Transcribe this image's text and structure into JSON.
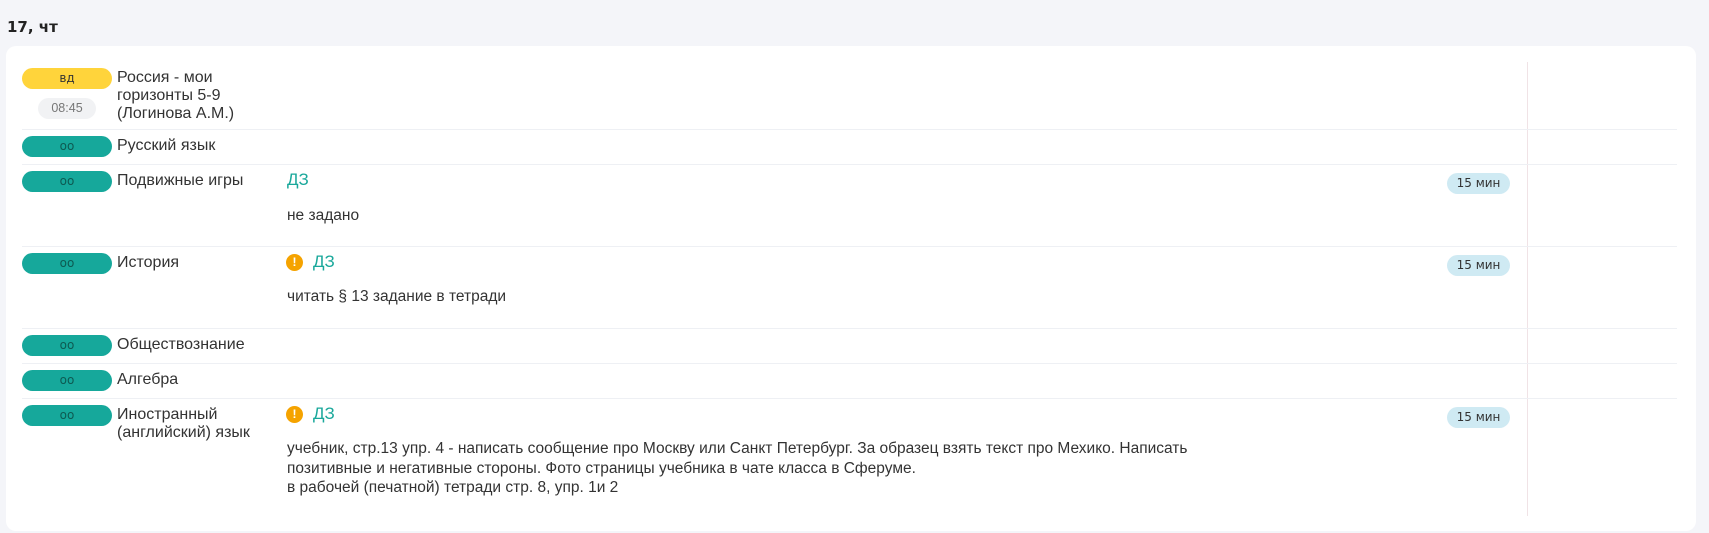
{
  "day": {
    "label": "17, чт"
  },
  "lessons": [
    {
      "badge": "вд",
      "time": "08:45",
      "subject": "Россия - мои горизонты 5-9 (Логинова А.М.)"
    },
    {
      "badge": "оо",
      "subject": "Русский язык"
    },
    {
      "badge": "оо",
      "subject": "Подвижные игры",
      "hw_label": "ДЗ",
      "hw_text": "не задано",
      "duration": "15 мин"
    },
    {
      "badge": "оо",
      "subject": "История",
      "hw_label": "ДЗ",
      "hw_text": "читать § 13 задание в тетради",
      "duration": "15 мин"
    },
    {
      "badge": "оо",
      "subject": "Обществознание"
    },
    {
      "badge": "оо",
      "subject": "Алгебра"
    },
    {
      "badge": "оо",
      "subject": "Иностранный (английский) язык",
      "hw_label": "ДЗ",
      "hw_lines": [
        "учебник, стр.13 упр. 4 - написать сообщение про Москву или Санкт Петербург. За образец взять текст про Мехико. Написать",
        "позитивные и негативные стороны. Фото страницы учебника в чате класса в Сферуме.",
        "в рабочей (печатной) тетради стр. 8, упр. 1и 2"
      ],
      "duration": "15 мин"
    }
  ],
  "colors": {
    "badge_yellow": "#ffd43b",
    "badge_teal": "#16a89b",
    "hw_link": "#1aa89b",
    "warning": "#f5a300",
    "duration_chip": "#cfeaf3"
  },
  "icons": {
    "warning": "exclamation-circle-icon"
  }
}
